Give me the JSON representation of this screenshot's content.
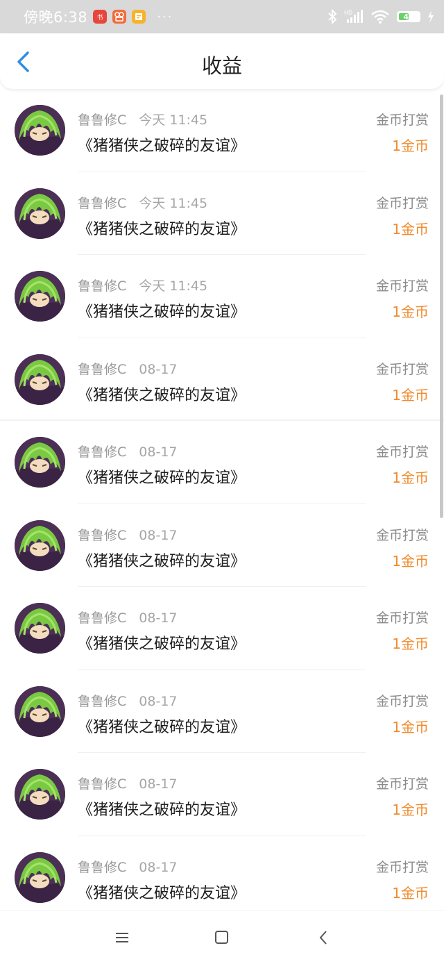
{
  "status_bar": {
    "time": "傍晚6:38",
    "battery_level": "46",
    "app_icons": [
      "xiaohongshu-icon",
      "app-icon",
      "notes-icon"
    ],
    "system_icons": [
      "bluetooth-icon",
      "signal-icon",
      "wifi-icon",
      "battery-icon",
      "charging-icon"
    ]
  },
  "header": {
    "title": "收益",
    "back_icon": "back-chevron-icon"
  },
  "earnings": [
    {
      "user": "鲁鲁修C",
      "time": "今天 11:45",
      "work": "《猪猪侠之破碎的友谊》",
      "type": "金币打赏",
      "amount": "1金币"
    },
    {
      "user": "鲁鲁修C",
      "time": "今天 11:45",
      "work": "《猪猪侠之破碎的友谊》",
      "type": "金币打赏",
      "amount": "1金币"
    },
    {
      "user": "鲁鲁修C",
      "time": "今天 11:45",
      "work": "《猪猪侠之破碎的友谊》",
      "type": "金币打赏",
      "amount": "1金币"
    },
    {
      "user": "鲁鲁修C",
      "time": "08-17",
      "work": "《猪猪侠之破碎的友谊》",
      "type": "金币打赏",
      "amount": "1金币"
    },
    {
      "user": "鲁鲁修C",
      "time": "08-17",
      "work": "《猪猪侠之破碎的友谊》",
      "type": "金币打赏",
      "amount": "1金币"
    },
    {
      "user": "鲁鲁修C",
      "time": "08-17",
      "work": "《猪猪侠之破碎的友谊》",
      "type": "金币打赏",
      "amount": "1金币"
    },
    {
      "user": "鲁鲁修C",
      "time": "08-17",
      "work": "《猪猪侠之破碎的友谊》",
      "type": "金币打赏",
      "amount": "1金币"
    },
    {
      "user": "鲁鲁修C",
      "time": "08-17",
      "work": "《猪猪侠之破碎的友谊》",
      "type": "金币打赏",
      "amount": "1金币"
    },
    {
      "user": "鲁鲁修C",
      "time": "08-17",
      "work": "《猪猪侠之破碎的友谊》",
      "type": "金币打赏",
      "amount": "1金币"
    },
    {
      "user": "鲁鲁修C",
      "time": "08-17",
      "work": "《猪猪侠之破碎的友谊》",
      "type": "金币打赏",
      "amount": "1金币"
    }
  ],
  "colors": {
    "amount": "#f08c2e",
    "back_icon": "#2f8de4",
    "status_bar_bg": "#d9d9d9"
  },
  "nav_bar": {
    "buttons": [
      "menu-icon",
      "home-icon",
      "back-icon"
    ]
  }
}
